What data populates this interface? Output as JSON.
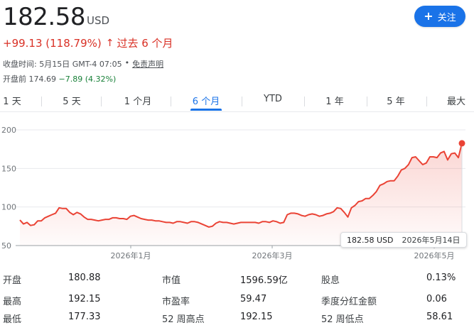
{
  "quote": {
    "price": "182.58",
    "currency": "USD",
    "change": "+99.13 (118.79%)",
    "change_arrow": "↑",
    "period_text": "过去 6 个月",
    "close_time": "收盘时间: 5月15日 GMT-4 07:05",
    "bullet": "•",
    "disclaimer": "免责声明",
    "premarket_label": "开盘前",
    "premarket_price": "174.69",
    "premarket_change": "−7.89 (4.32%)"
  },
  "follow_button": {
    "icon": "plus-icon",
    "label": "关注"
  },
  "tabs": [
    {
      "label": "1 天"
    },
    {
      "label": "5 天"
    },
    {
      "label": "1 个月"
    },
    {
      "label": "6 个月"
    },
    {
      "label": "YTD"
    },
    {
      "label": "1 年"
    },
    {
      "label": "5 年"
    },
    {
      "label": "最大"
    }
  ],
  "active_tab": "6 个月",
  "tooltip": {
    "price": "182.58 USD",
    "date": "2026年5月14日"
  },
  "colors": {
    "accent": "#1a73e8",
    "up": "#d93025",
    "down": "#188038",
    "line": "#ea4335"
  },
  "chart_data": {
    "type": "area",
    "title": "",
    "xlabel": "",
    "ylabel": "",
    "ylim": [
      50,
      200
    ],
    "yticks": [
      50,
      100,
      150,
      200
    ],
    "xticks": [
      "2026年1月",
      "2026年3月",
      "2026年5月"
    ],
    "grid": true,
    "series": [
      {
        "values": [
          83,
          78,
          80,
          76,
          77,
          82,
          82,
          86,
          88,
          90,
          92,
          99,
          98,
          98,
          93,
          90,
          93,
          91,
          87,
          84,
          84,
          83,
          82,
          83,
          84,
          84,
          86,
          86,
          85,
          85,
          84,
          88,
          89,
          87,
          85,
          84,
          83,
          83,
          82,
          82,
          81,
          80,
          80,
          79,
          81,
          81,
          80,
          79,
          81,
          81,
          80,
          78,
          76,
          74,
          75,
          79,
          81,
          80,
          80,
          79,
          78,
          79,
          80,
          80,
          80,
          80,
          80,
          79,
          81,
          81,
          80,
          82,
          81,
          79,
          80,
          90,
          92,
          92,
          91,
          89,
          88,
          90,
          91,
          90,
          88,
          89,
          91,
          92,
          94,
          99,
          98,
          93,
          87,
          99,
          102,
          107,
          108,
          111,
          111,
          115,
          120,
          128,
          130,
          133,
          134,
          134,
          140,
          148,
          150,
          155,
          164,
          165,
          160,
          155,
          157,
          165,
          165,
          164,
          170,
          172,
          161,
          169,
          170,
          164,
          182.58
        ]
      }
    ]
  },
  "stats": [
    [
      {
        "label": "开盘",
        "value": "180.88"
      },
      {
        "label": "市值",
        "value": "1596.59亿"
      },
      {
        "label": "股息",
        "value": "0.13%"
      }
    ],
    [
      {
        "label": "最高",
        "value": "192.15"
      },
      {
        "label": "市盈率",
        "value": "59.47"
      },
      {
        "label": "季度分红金额",
        "value": "0.06"
      }
    ],
    [
      {
        "label": "最低",
        "value": "177.33"
      },
      {
        "label": "52 周高点",
        "value": "192.15"
      },
      {
        "label": "52 周低点",
        "value": "58.61"
      }
    ]
  ]
}
